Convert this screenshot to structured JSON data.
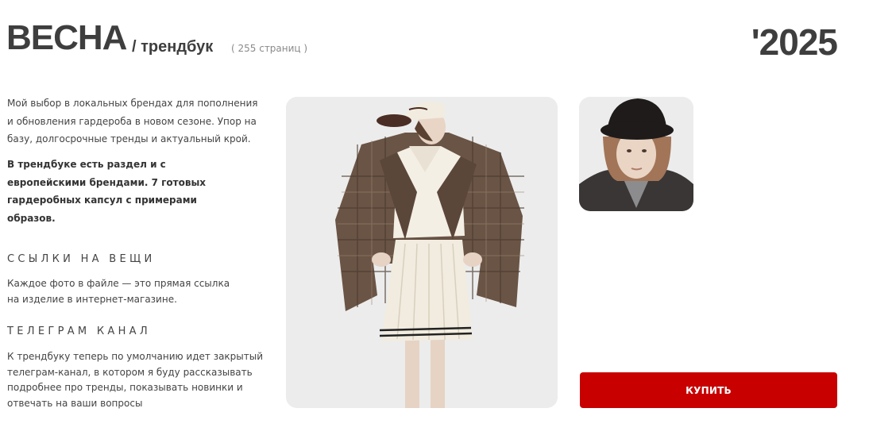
{
  "header": {
    "title": "ВЕСНА",
    "subtitle": "/ трендбук",
    "pages": "( 255 страниц )",
    "year": "'2025"
  },
  "intro": {
    "text": "Мой выбор в локальных брендах для пополнения и обновления гардероба в новом сезоне. Упор на базу, долгосрочные тренды и актуальный крой.",
    "bold_text": "В трендбуке есть раздел и с европейскими брендами. 7 готовых гардеробных капсул с примерами образов."
  },
  "links_section": {
    "heading": "ССЫЛКИ НА ВЕЩИ",
    "text": "Каждое фото в файле — это прямая ссылка на изделие в интернет-магазине."
  },
  "telegram_section": {
    "heading": "ТЕЛЕГРАМ КАНАЛ",
    "text": "К трендбуку теперь по умолчанию идет закрытый телеграм-канал, в котором я буду рассказывать подробнее про тренды, показывать новинки и отвечать на ваши вопросы"
  },
  "buy_button": {
    "label": "КУПИТЬ"
  },
  "colors": {
    "accent": "#c80000",
    "title": "#3e3e3e",
    "photo_bg": "#ececec"
  }
}
